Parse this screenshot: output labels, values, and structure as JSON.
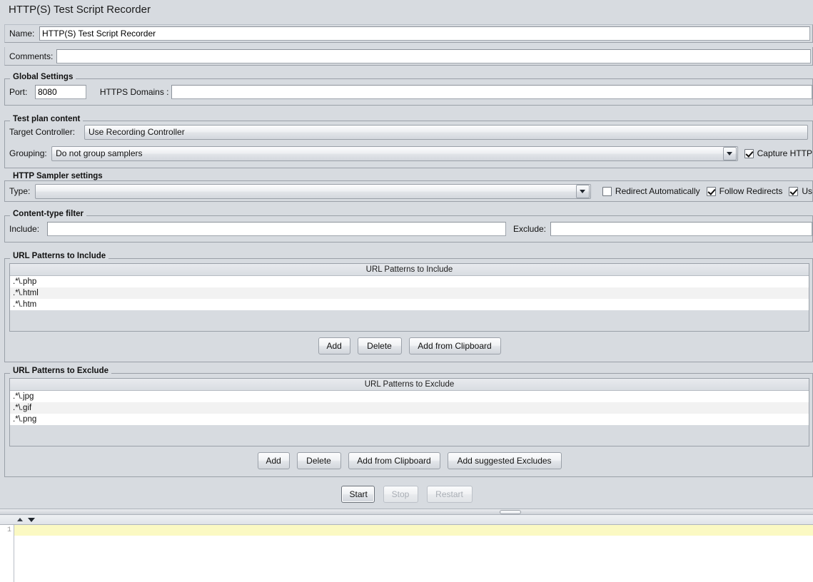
{
  "window": {
    "title": "HTTP(S) Test Script Recorder"
  },
  "identity": {
    "name_label": "Name:",
    "name_value": "HTTP(S) Test Script Recorder",
    "comments_label": "Comments:",
    "comments_value": "",
    "comments_placeholder": ""
  },
  "global_settings": {
    "group_label": "Global Settings",
    "port_label": "Port:",
    "port_value": "8080",
    "https_domains_label": "HTTPS Domains :",
    "https_domains_value": ""
  },
  "test_plan_content": {
    "group_label": "Test plan content",
    "target_controller_label": "Target Controller:",
    "target_controller_value": "Use Recording Controller",
    "grouping_label": "Grouping:",
    "grouping_value": "Do not group samplers",
    "capture_http_label": "Capture HTTP",
    "capture_http_checked": true
  },
  "http_sampler_settings": {
    "group_label": "HTTP Sampler settings",
    "type_label": "Type:",
    "type_value": "",
    "redirect_automatically_label": "Redirect Automatically",
    "redirect_automatically_checked": false,
    "follow_redirects_label": "Follow Redirects",
    "follow_redirects_checked": true,
    "use_keepalive_label": "Us",
    "use_keepalive_checked": true
  },
  "content_type_filter": {
    "group_label": "Content-type filter",
    "include_label": "Include:",
    "include_value": "",
    "exclude_label": "Exclude:",
    "exclude_value": ""
  },
  "url_include": {
    "group_label": "URL Patterns to Include",
    "column_header": "URL Patterns to Include",
    "rows": [
      ".*\\.php",
      ".*\\.html",
      ".*\\.htm"
    ],
    "buttons": [
      "Add",
      "Delete",
      "Add from Clipboard"
    ]
  },
  "url_exclude": {
    "group_label": "URL Patterns to Exclude",
    "column_header": "URL Patterns to Exclude",
    "rows": [
      ".*\\.jpg",
      ".*\\.gif",
      ".*\\.png"
    ],
    "buttons": [
      "Add",
      "Delete",
      "Add from Clipboard",
      "Add suggested Excludes"
    ]
  },
  "recorder_controls": {
    "start_label": "Start",
    "stop_label": "Stop",
    "restart_label": "Restart",
    "start_enabled": true,
    "stop_enabled": false,
    "restart_enabled": false
  },
  "editor": {
    "line_number": "1",
    "line_text": ""
  },
  "colors": {
    "background": "#d7dbe0",
    "field_background": "#ffffff",
    "highlight_line": "#fbf9c3",
    "row_alt": "#f2f2f2",
    "border": "#9aa0a8"
  }
}
